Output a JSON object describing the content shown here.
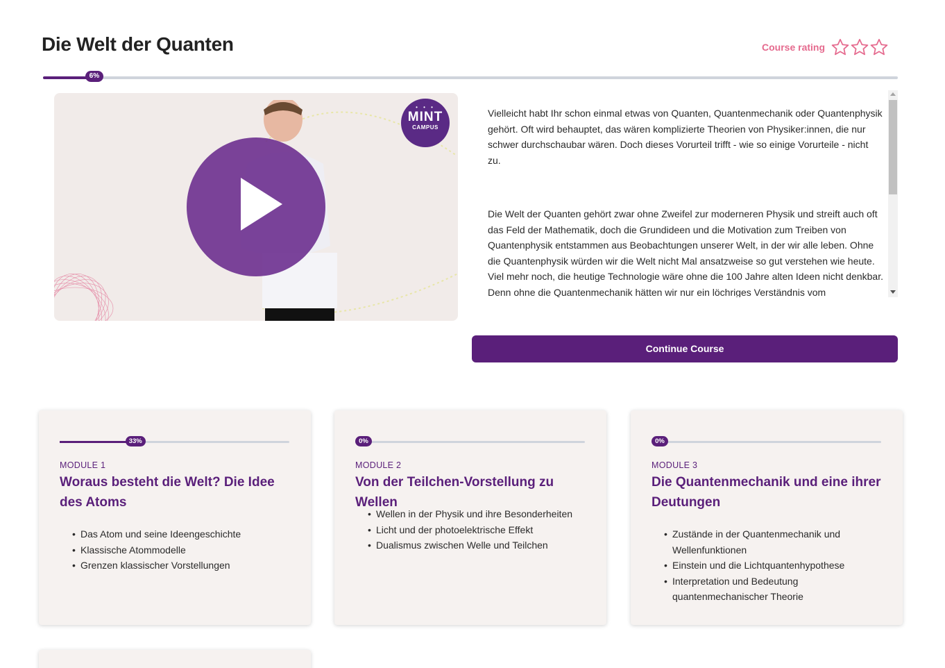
{
  "course": {
    "title": "Die Welt der Quanten",
    "progress_percent": 6,
    "progress_label": "6%"
  },
  "rating": {
    "label": "Course rating",
    "stars_filled": 0,
    "stars_total": 3
  },
  "video": {
    "logo_top": "MINT",
    "logo_bottom": "CAMPUS"
  },
  "description": {
    "paragraphs": [
      "Vielleicht habt Ihr schon einmal etwas von Quanten, Quantenmechanik oder Quantenphysik gehört. Oft wird behauptet, das wären komplizierte Theorien von Physiker:innen, die nur schwer durchschaubar wären. Doch dieses Vorurteil trifft - wie so einige Vorurteile - nicht zu.",
      "Die Welt der Quanten gehört zwar ohne Zweifel zur moderneren Physik und streift auch oft das Feld der Mathematik, doch die Grundideen und die Motivation zum Treiben von Quantenphysik entstammen aus Beobachtungen unserer Welt, in der wir alle leben. Ohne die Quantenphysik würden wir die Welt nicht Mal ansatzweise so gut verstehen wie heute. Viel mehr noch, die heutige Technologie wäre ohne die 100 Jahre alten Ideen nicht denkbar. Denn ohne die Quantenmechanik hätten wir nur ein löchriges Verständnis vom"
    ]
  },
  "continue_button": "Continue Course",
  "modules": [
    {
      "label": "MODULE 1",
      "title": "Woraus besteht die Welt? Die Idee des Atoms",
      "progress_percent": 33,
      "progress_label": "33%",
      "topics": [
        "Das Atom und seine Ideengeschichte",
        "Klassische Atommodelle",
        "Grenzen klassischer Vorstellungen"
      ]
    },
    {
      "label": "MODULE 2",
      "title": "Von der Teilchen-Vorstellung zu Wellen",
      "progress_percent": 0,
      "progress_label": "0%",
      "topics": [
        "Wellen in der Physik und ihre Besonderheiten",
        "Licht und der photoelektrische Effekt",
        "Dualismus zwischen Welle und Teilchen"
      ]
    },
    {
      "label": "MODULE 3",
      "title": "Die Quantenmechanik und eine ihrer Deutungen",
      "progress_percent": 0,
      "progress_label": "0%",
      "topics": [
        "Zustände in der Quantenmechanik und Wellenfunktionen",
        "Einstein und die Lichtquantenhypothese",
        "Interpretation und Bedeutung quantenmechanischer Theorie"
      ]
    }
  ],
  "colors": {
    "brand": "#5a1f7a",
    "rating": "#e56a8e",
    "track": "#cfd4dc",
    "card_bg": "#f6f2f0"
  }
}
